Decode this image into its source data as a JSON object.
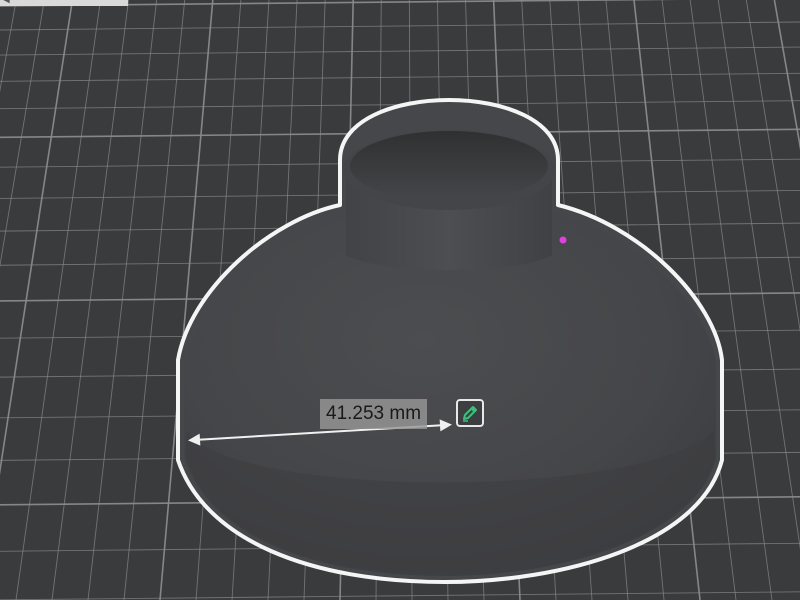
{
  "viewport": {
    "background_color": "#3a3b3d",
    "grid_color": "#8a8b8d",
    "model_color": "#4a4b4d",
    "outline_color": "#f5f5f5",
    "marker_color": "#e040e0"
  },
  "measurement": {
    "value_label": "41.253 mm",
    "edit_icon": "pencil-edit-icon",
    "edit_icon_color": "#3fbf7f"
  },
  "top_strip": {
    "icon": "arrow-left-icon"
  }
}
